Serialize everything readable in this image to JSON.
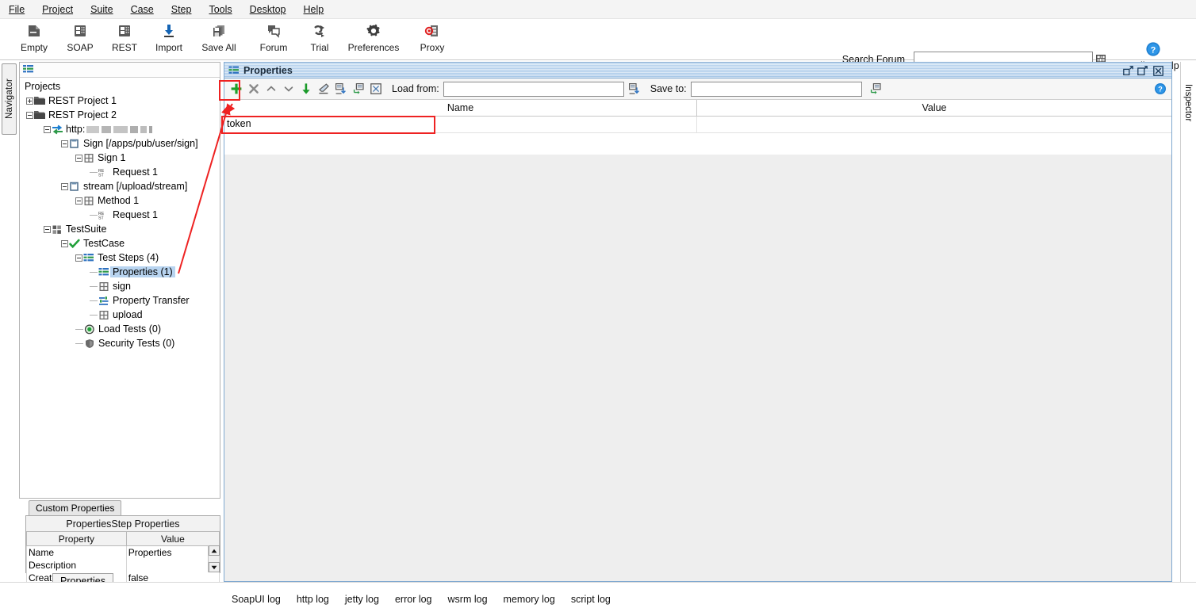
{
  "menubar": {
    "items": [
      {
        "label": "File"
      },
      {
        "label": "Project"
      },
      {
        "label": "Suite"
      },
      {
        "label": "Case"
      },
      {
        "label": "Step"
      },
      {
        "label": "Tools"
      },
      {
        "label": "Desktop"
      },
      {
        "label": "Help"
      }
    ]
  },
  "toolbar": {
    "buttons": [
      {
        "label": "Empty",
        "icon": "empty-project-icon"
      },
      {
        "label": "SOAP",
        "icon": "soap-project-icon"
      },
      {
        "label": "REST",
        "icon": "rest-project-icon"
      },
      {
        "label": "Import",
        "icon": "import-icon"
      },
      {
        "label": "Save All",
        "icon": "save-all-icon"
      },
      {
        "label": "Forum",
        "icon": "forum-icon"
      },
      {
        "label": "Trial",
        "icon": "trial-icon"
      },
      {
        "label": "Preferences",
        "icon": "gear-icon"
      },
      {
        "label": "Proxy",
        "icon": "proxy-icon"
      }
    ],
    "search_forum_label": "Search Forum",
    "search_forum_value": "",
    "search_forum_placeholder": "",
    "online_help_label": "Online Help"
  },
  "left_rail": {
    "navigator_label": "Navigator"
  },
  "right_rail": {
    "inspector_label": "Inspector"
  },
  "navigator": {
    "root_label": "Projects",
    "tree": [
      {
        "label": "REST Project 1",
        "depth": 1,
        "twisty": "plus",
        "icon": "folder-icon"
      },
      {
        "label": "REST Project 2",
        "depth": 1,
        "twisty": "minus",
        "icon": "folder-icon"
      },
      {
        "label": "http:",
        "depth": 2,
        "twisty": "minus",
        "icon": "endpoint-icon",
        "redacted": true
      },
      {
        "label": "Sign [/apps/pub/user/sign]",
        "depth": 3,
        "twisty": "minus",
        "icon": "resource-icon"
      },
      {
        "label": "Sign 1",
        "depth": 4,
        "twisty": "minus",
        "icon": "method-icon"
      },
      {
        "label": "Request 1",
        "depth": 5,
        "twisty": "none",
        "icon": "rest-request-icon"
      },
      {
        "label": "stream [/upload/stream]",
        "depth": 3,
        "twisty": "minus",
        "icon": "resource-icon"
      },
      {
        "label": "Method 1",
        "depth": 4,
        "twisty": "minus",
        "icon": "method-icon"
      },
      {
        "label": "Request 1",
        "depth": 5,
        "twisty": "none",
        "icon": "rest-request-icon"
      },
      {
        "label": "TestSuite",
        "depth": 2,
        "twisty": "minus",
        "icon": "testsuite-icon"
      },
      {
        "label": "TestCase",
        "depth": 3,
        "twisty": "minus",
        "icon": "checkmark-icon"
      },
      {
        "label": "Test Steps (4)",
        "depth": 4,
        "twisty": "minus",
        "icon": "teststeps-icon"
      },
      {
        "label": "Properties (1)",
        "depth": 5,
        "twisty": "none",
        "icon": "properties-step-icon",
        "selected": true
      },
      {
        "label": "sign",
        "depth": 5,
        "twisty": "none",
        "icon": "method-icon"
      },
      {
        "label": "Property Transfer",
        "depth": 5,
        "twisty": "none",
        "icon": "property-transfer-icon"
      },
      {
        "label": "upload",
        "depth": 5,
        "twisty": "none",
        "icon": "method-icon"
      },
      {
        "label": "Load Tests (0)",
        "depth": 4,
        "twisty": "none",
        "icon": "load-tests-icon"
      },
      {
        "label": "Security Tests (0)",
        "depth": 4,
        "twisty": "none",
        "icon": "security-tests-icon"
      }
    ]
  },
  "custom_properties": {
    "tab_label": "Custom Properties",
    "title": "PropertiesStep Properties",
    "columns": [
      "Property",
      "Value"
    ],
    "rows": [
      {
        "property": "Name",
        "value": "Properties"
      },
      {
        "property": "Description",
        "value": ""
      },
      {
        "property": "Create Missing o...",
        "value": "false"
      }
    ],
    "bottom_tab_label": "Properties"
  },
  "properties_panel": {
    "title": "Properties",
    "title_icon": "properties-step-icon",
    "window_buttons": [
      {
        "name": "maximize-restore-button",
        "icon": "restore-icon"
      },
      {
        "name": "detach-button",
        "icon": "detach-icon"
      },
      {
        "name": "close-panel-button",
        "icon": "close-icon"
      }
    ],
    "toolbar": {
      "buttons": [
        {
          "name": "add-property-button",
          "icon": "plus-icon"
        },
        {
          "name": "remove-property-button",
          "icon": "x-icon"
        },
        {
          "name": "move-up-button",
          "icon": "chevron-up-icon"
        },
        {
          "name": "move-down-button",
          "icon": "chevron-down-icon"
        },
        {
          "name": "sort-button",
          "icon": "down-arrow-icon"
        },
        {
          "name": "clear-values-button",
          "icon": "eraser-icon"
        },
        {
          "name": "load-properties-button",
          "icon": "load-icon"
        },
        {
          "name": "save-properties-button",
          "icon": "save-icon"
        },
        {
          "name": "test-properties-button",
          "icon": "dialog-icon"
        }
      ],
      "load_from_label": "Load from:",
      "load_from_value": "",
      "load_from_browse_icon": "browse-load-icon",
      "save_to_label": "Save to:",
      "save_to_value": "",
      "save_to_browse_icon": "browse-save-icon",
      "help_icon": "help-icon"
    },
    "table": {
      "columns": [
        "Name",
        "Value"
      ],
      "rows": [
        {
          "name": "token",
          "value": ""
        }
      ]
    }
  },
  "log_tabs": [
    {
      "label": "SoapUI log"
    },
    {
      "label": "http log"
    },
    {
      "label": "jetty log"
    },
    {
      "label": "error log"
    },
    {
      "label": "wsrm log"
    },
    {
      "label": "memory log"
    },
    {
      "label": "script log"
    }
  ],
  "annotations": {
    "accent_color": "#ee2222",
    "highlight_add_button": true,
    "highlight_token_row": true,
    "arrow_from_token_row_to_add_button": true
  },
  "colors": {
    "panel_title_blue": "#a8c8e8",
    "selection_blue": "#b8d4f0",
    "green_plus": "#22a02a",
    "annotation_red": "#ee2222"
  }
}
